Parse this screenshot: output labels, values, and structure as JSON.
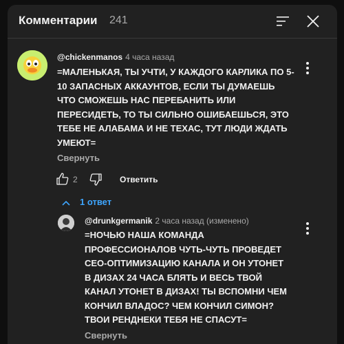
{
  "header": {
    "title": "Комментарии",
    "count": "241"
  },
  "comments": [
    {
      "author": "@chickenmanos",
      "time": "4 часа назад",
      "text_lines": [
        "=МАЛЕНЬКАЯ, ТЫ УЧТИ, У КАЖДОГО КАРЛИКА ПО 5-",
        "10 ЗАПАСНЫХ АККАУНТОВ, ЕСЛИ ТЫ ДУМАЕШЬ",
        "ЧТО СМОЖЕШЬ НАС ПЕРЕБАНИТЬ ИЛИ",
        "ПЕРЕСИДЕТЬ, ТО ТЫ СИЛЬНО ОШИБАЕШЬСЯ, ЭТО",
        "ТЕБЕ НЕ АЛАБАМА И НЕ ТЕХАС, ТУТ ЛЮДИ ЖДАТЬ",
        "УМЕЮТ="
      ],
      "collapse_label": "Свернуть",
      "likes": "2",
      "reply_label": "Ответить",
      "replies_label": "1 ответ"
    }
  ],
  "replies": [
    {
      "author": "@drunkgermanik",
      "time": "2 часа назад (изменено)",
      "text_lines": [
        "=НОЧЬЮ НАША КОМАНДА",
        "ПРОФЕССИОНАЛОВ ЧУТЬ-ЧУТЬ ПРОВЕДЕТ",
        "СЕО-ОПТИМИЗАЦИЮ КАНАЛА И ОН УТОНЕТ",
        "В ДИЗАХ 24 ЧАСА БЛЯТЬ И ВЕСЬ ТВОЙ",
        "КАНАЛ УТОНЕТ В ДИЗАХ! ТЫ ВСПОМНИ ЧЕМ",
        "КОНЧИЛ ВЛАДОС? ЧЕМ КОНЧИЛ СИМОН?",
        "ТВОИ РЕНДНЕКИ ТЕБЯ НЕ СПАСУТ="
      ],
      "collapse_label": "Свернуть"
    }
  ],
  "icons": {
    "sort": "sort-icon",
    "close": "close-icon",
    "more": "more-vert-icon",
    "like": "thumb-up-icon",
    "dislike": "thumb-down-icon",
    "chevron": "chevron-up-icon"
  },
  "colors": {
    "background": "#0f0f0f",
    "panel": "#212121",
    "text": "#f1f1f1",
    "secondary_text": "#aaaaaa",
    "link": "#3ea6ff"
  }
}
